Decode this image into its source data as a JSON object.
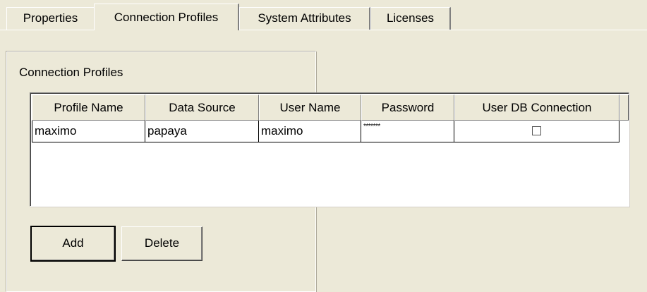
{
  "tabs": [
    {
      "label": "Properties",
      "active": false
    },
    {
      "label": "Connection Profiles",
      "active": true
    },
    {
      "label": "System Attributes",
      "active": false
    },
    {
      "label": "Licenses",
      "active": false
    }
  ],
  "group": {
    "title": "Connection Profiles"
  },
  "table": {
    "columns": [
      "Profile Name",
      "Data Source",
      "User Name",
      "Password",
      "User DB Connection"
    ],
    "rows": [
      {
        "profile_name": "maximo",
        "data_source": "papaya",
        "user_name": "maximo",
        "password": "*******",
        "user_db_connection": false
      }
    ]
  },
  "buttons": {
    "add": "Add",
    "delete": "Delete"
  }
}
